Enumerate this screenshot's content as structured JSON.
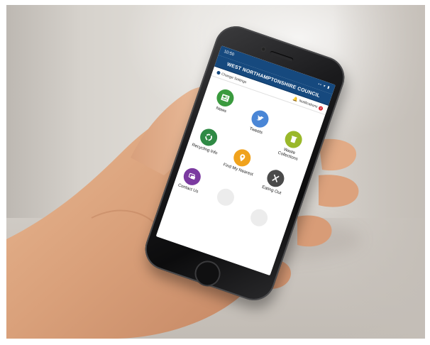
{
  "app": {
    "status_time": "10:50",
    "status_icons": "•• ▾ ▮",
    "title": "WEST NORTHAMPTONSHIRE COUNCIL",
    "change_settings": "Change Settings",
    "notifications": "Notifications",
    "notification_count": "3",
    "brand_color": "#16497e"
  },
  "tiles": [
    {
      "label": "News",
      "color": "#3a9a3e",
      "icon": "newspaper-icon"
    },
    {
      "label": "Tweets",
      "color": "#4a86d6",
      "icon": "bird-icon"
    },
    {
      "label": "Waste Collections",
      "color": "#9ab82a",
      "icon": "bin-icon"
    },
    {
      "label": "Recycling Info",
      "color": "#2f8a45",
      "icon": "recycle-icon"
    },
    {
      "label": "Find My Nearest",
      "color": "#f0a21c",
      "icon": "location-pin-icon"
    },
    {
      "label": "Eating Out",
      "color": "#4a4a4a",
      "icon": "cutlery-icon"
    },
    {
      "label": "Contact Us",
      "color": "#7b3aa0",
      "icon": "chat-icon"
    }
  ]
}
